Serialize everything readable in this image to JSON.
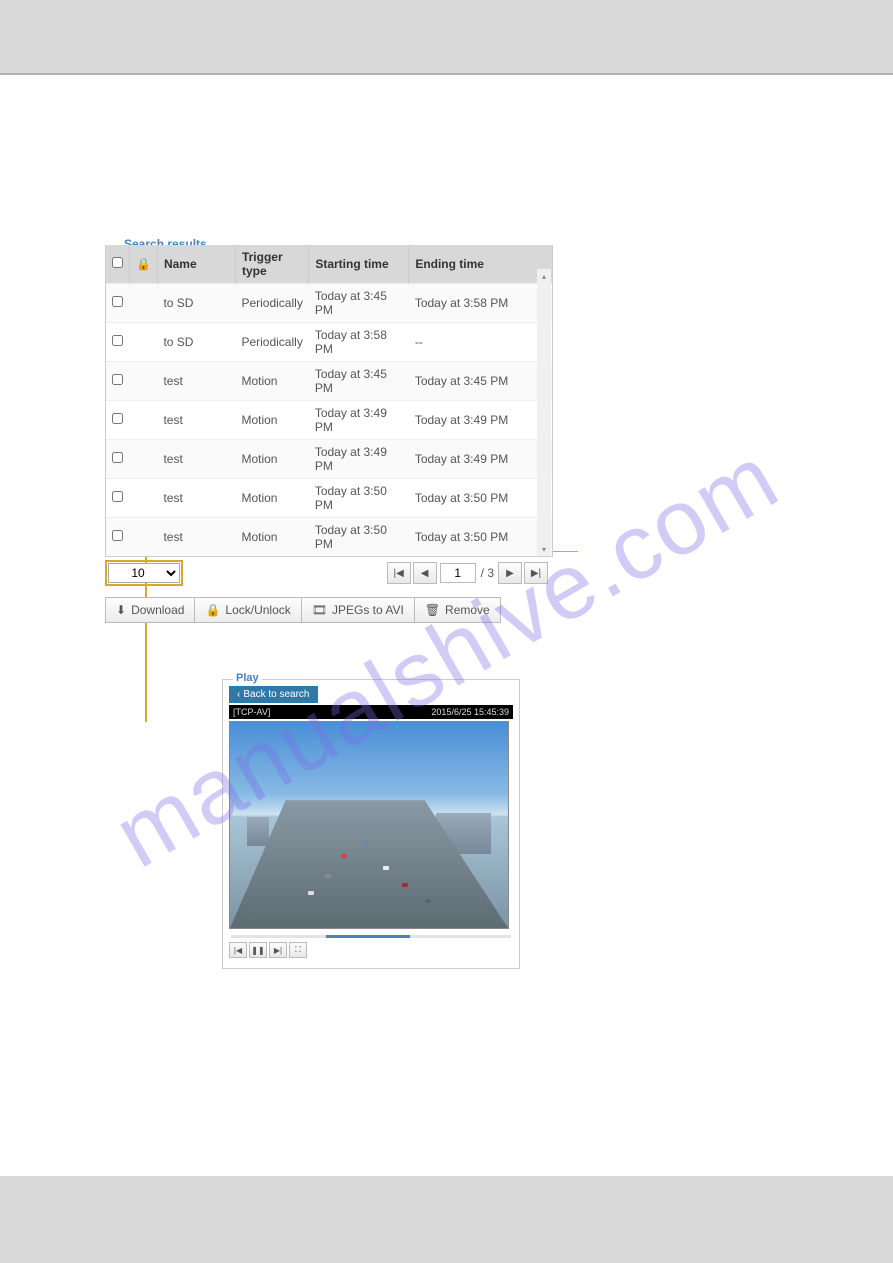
{
  "watermark": "manualshive.com",
  "search": {
    "legend": "Search results",
    "columns": {
      "chk": "",
      "lock": "",
      "name": "Name",
      "trigger": "Trigger type",
      "start": "Starting time",
      "end": "Ending time"
    },
    "rows": [
      {
        "name": "to SD",
        "trigger": "Periodically",
        "start": "Today at 3:45 PM",
        "end": "Today at 3:58 PM"
      },
      {
        "name": "to SD",
        "trigger": "Periodically",
        "start": "Today at 3:58 PM",
        "end": "--"
      },
      {
        "name": "test",
        "trigger": "Motion",
        "start": "Today at 3:45 PM",
        "end": "Today at 3:45 PM"
      },
      {
        "name": "test",
        "trigger": "Motion",
        "start": "Today at 3:49 PM",
        "end": "Today at 3:49 PM"
      },
      {
        "name": "test",
        "trigger": "Motion",
        "start": "Today at 3:49 PM",
        "end": "Today at 3:49 PM"
      },
      {
        "name": "test",
        "trigger": "Motion",
        "start": "Today at 3:50 PM",
        "end": "Today at 3:50 PM"
      },
      {
        "name": "test",
        "trigger": "Motion",
        "start": "Today at 3:50 PM",
        "end": "Today at 3:50 PM"
      }
    ],
    "per_page": "10",
    "page_current": "1",
    "page_total": "/ 3"
  },
  "actions": {
    "download": "Download",
    "lock": "Lock/Unlock",
    "jpeg": "JPEGs to AVI",
    "remove": "Remove"
  },
  "play": {
    "legend": "Play",
    "back": "Back to search",
    "overlay_left": "[TCP-AV]",
    "overlay_right": "2015/6/25 15:45:39"
  }
}
